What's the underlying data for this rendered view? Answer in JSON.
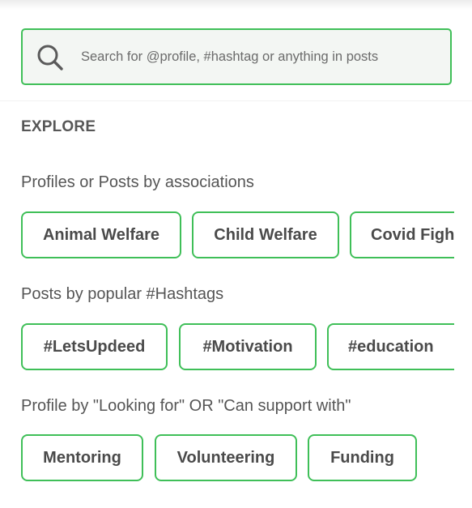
{
  "search": {
    "placeholder": "Search for @profile, #hashtag or anything in posts",
    "icon": "search-icon"
  },
  "explore": {
    "title": "EXPLORE"
  },
  "sections": {
    "associations": {
      "title": "Profiles or Posts by associations",
      "chips": [
        "Animal Welfare",
        "Child Welfare",
        "Covid Figh"
      ]
    },
    "hashtags": {
      "title": "Posts by popular #Hashtags",
      "chips": [
        "#LetsUpdeed",
        "#Motivation",
        "#education"
      ]
    },
    "looking_for": {
      "title": "Profile by \"Looking for\" OR \"Can support with\"",
      "chips": [
        "Mentoring",
        "Volunteering",
        "Funding"
      ]
    }
  },
  "colors": {
    "accent": "#3fbf58",
    "text": "#4a4a4a",
    "search_bg": "#f3f6f3"
  }
}
